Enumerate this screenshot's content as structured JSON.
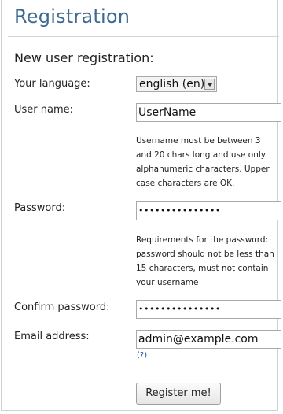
{
  "page": {
    "title": "Registration",
    "section_heading": "New user registration:"
  },
  "fields": {
    "language": {
      "label": "Your language:",
      "selected": "english (en)"
    },
    "username": {
      "label": "User name:",
      "value": "UserName",
      "hint": "Username must be between 3 and 20 chars long and use only alphanumeric characters. Upper case characters are OK."
    },
    "password": {
      "label": "Password:",
      "value": "•••••••••••••••",
      "hint": "Requirements for the password: password should not be less than 15 characters, must not contain your username"
    },
    "confirm_password": {
      "label": "Confirm password:",
      "value": "•••••••••••••••"
    },
    "email": {
      "label": "Email address:",
      "value": "admin@example.com",
      "help_link": "(?)"
    }
  },
  "actions": {
    "submit_label": "Register me!"
  },
  "colors": {
    "title": "#3d6a92",
    "link": "#1a4a9a"
  },
  "icons": {
    "select_arrow": "chevron-down-icon"
  }
}
